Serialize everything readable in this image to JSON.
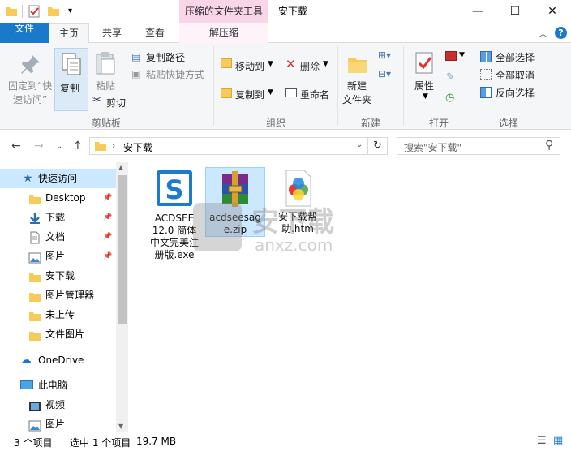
{
  "window": {
    "title": "安下载",
    "context_tab_header": "压缩的文件夹工具",
    "minimize": "—",
    "maximize": "☐",
    "close": "✕"
  },
  "tabs": {
    "file": "文件",
    "home": "主页",
    "share": "共享",
    "view": "查看",
    "decompress": "解压缩"
  },
  "ribbon": {
    "clipboard": {
      "label": "剪贴板",
      "pin_quick_access": [
        "固定到“快",
        "速访问”"
      ],
      "copy": "复制",
      "paste": "粘贴",
      "copy_path": "复制路径",
      "paste_shortcut": "粘贴快捷方式",
      "cut": "剪切"
    },
    "organize": {
      "label": "组织",
      "move_to": "移动到",
      "copy_to": "复制到",
      "delete": "删除",
      "rename": "重命名"
    },
    "new": {
      "label": "新建",
      "new_folder": [
        "新建",
        "文件夹"
      ]
    },
    "open": {
      "label": "打开",
      "properties": "属性"
    },
    "select": {
      "label": "选择",
      "select_all": "全部选择",
      "select_none": "全部取消",
      "invert": "反向选择"
    }
  },
  "address": {
    "path": "安下载",
    "search_placeholder": "搜索\"安下载\""
  },
  "nav": {
    "quick_access": "快速访问",
    "items": [
      {
        "label": "Desktop",
        "icon": "folder-icon",
        "pinned": true
      },
      {
        "label": "下载",
        "icon": "download-icon",
        "pinned": true
      },
      {
        "label": "文档",
        "icon": "document-icon",
        "pinned": true
      },
      {
        "label": "图片",
        "icon": "pictures-icon",
        "pinned": true
      },
      {
        "label": "安下载",
        "icon": "folder-icon",
        "pinned": false
      },
      {
        "label": "图片管理器",
        "icon": "folder-icon",
        "pinned": false
      },
      {
        "label": "未上传",
        "icon": "folder-icon",
        "pinned": false
      },
      {
        "label": "文件图片",
        "icon": "folder-icon",
        "pinned": false
      }
    ],
    "onedrive": "OneDrive",
    "this_pc": "此电脑",
    "pc_items": [
      {
        "label": "视频",
        "icon": "video-icon"
      },
      {
        "label": "图片",
        "icon": "pictures-icon"
      }
    ]
  },
  "files": [
    {
      "name": [
        "ACDSEE",
        "12.0 简体",
        "中文完美注",
        "册版.exe"
      ],
      "icon": "acdsee-exe-icon",
      "selected": false
    },
    {
      "name": [
        "acdseesag",
        "e.zip"
      ],
      "icon": "winrar-zip-icon",
      "selected": true
    },
    {
      "name": [
        "安下载帮",
        "助.htm"
      ],
      "icon": "htm-file-icon",
      "selected": false
    }
  ],
  "watermark": {
    "text": "安下载",
    "sub": "anxz.com"
  },
  "status": {
    "count": "3 个项目",
    "selected": "选中 1 个项目",
    "size": "19.7 MB"
  },
  "colors": {
    "accent": "#1979ca",
    "context_tab": "#f8d6e8",
    "selection": "#cce8ff",
    "folder": "#f7ca5a"
  }
}
